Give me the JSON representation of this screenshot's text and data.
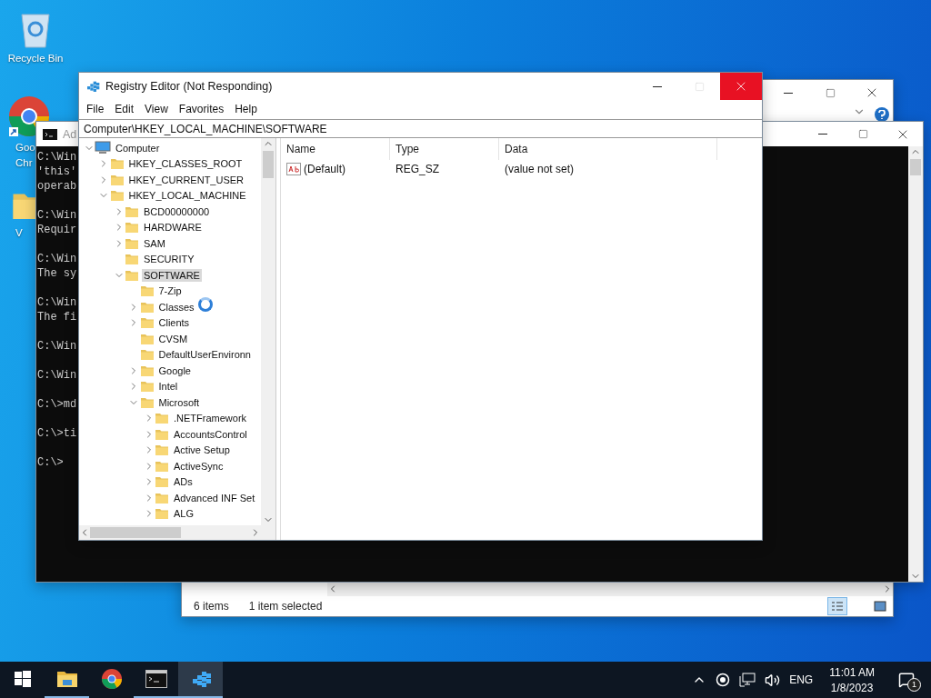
{
  "desktop_icons": [
    {
      "kind": "recycle",
      "lines": [
        "Recycle Bin"
      ]
    },
    {
      "kind": "chrome",
      "lines": [
        "Goo",
        "Chr"
      ]
    },
    {
      "kind": "folder",
      "lines": [
        "V"
      ]
    }
  ],
  "explorer_window": {
    "status_count": "6 items",
    "status_selected": "1 item selected"
  },
  "cmd_window": {
    "title": "Ad",
    "blocks": [
      [
        "C:\\Win",
        "'this'",
        "operab"
      ],
      [
        "C:\\Win",
        "Requir"
      ],
      [
        "C:\\Win",
        "The sy"
      ],
      [
        "C:\\Win",
        "The fi"
      ],
      [
        "C:\\Win"
      ],
      [
        "C:\\Win"
      ],
      [
        "C:\\>md"
      ],
      [
        "C:\\>ti"
      ],
      [
        "C:\\>"
      ]
    ]
  },
  "registry_editor": {
    "title": "Registry Editor (Not Responding)",
    "maximize_disabled": true,
    "close_hovered": true,
    "menu": [
      "File",
      "Edit",
      "View",
      "Favorites",
      "Help"
    ],
    "address": "Computer\\HKEY_LOCAL_MACHINE\\SOFTWARE",
    "tree": [
      {
        "label": "Computer",
        "kind": "computer",
        "expandable": true,
        "expanded": true,
        "selected": false,
        "children": [
          {
            "label": "HKEY_CLASSES_ROOT",
            "kind": "folder",
            "expandable": true,
            "expanded": false,
            "selected": false
          },
          {
            "label": "HKEY_CURRENT_USER",
            "kind": "folder",
            "expandable": true,
            "expanded": false,
            "selected": false
          },
          {
            "label": "HKEY_LOCAL_MACHINE",
            "kind": "folder",
            "expandable": true,
            "expanded": true,
            "selected": false,
            "children": [
              {
                "label": "BCD00000000",
                "kind": "folder",
                "expandable": true,
                "expanded": false,
                "selected": false
              },
              {
                "label": "HARDWARE",
                "kind": "folder",
                "expandable": true,
                "expanded": false,
                "selected": false
              },
              {
                "label": "SAM",
                "kind": "folder",
                "expandable": true,
                "expanded": false,
                "selected": false
              },
              {
                "label": "SECURITY",
                "kind": "folder",
                "expandable": false,
                "expanded": false,
                "selected": false
              },
              {
                "label": "SOFTWARE",
                "kind": "folder",
                "expandable": true,
                "expanded": true,
                "selected": true,
                "children": [
                  {
                    "label": "7-Zip",
                    "kind": "folder",
                    "expandable": false,
                    "expanded": false,
                    "selected": false
                  },
                  {
                    "label": "Classes",
                    "kind": "folder",
                    "expandable": true,
                    "expanded": false,
                    "selected": false
                  },
                  {
                    "label": "Clients",
                    "kind": "folder",
                    "expandable": true,
                    "expanded": false,
                    "selected": false
                  },
                  {
                    "label": "CVSM",
                    "kind": "folder",
                    "expandable": false,
                    "expanded": false,
                    "selected": false
                  },
                  {
                    "label": "DefaultUserEnvironn",
                    "kind": "folder",
                    "expandable": false,
                    "expanded": false,
                    "selected": false
                  },
                  {
                    "label": "Google",
                    "kind": "folder",
                    "expandable": true,
                    "expanded": false,
                    "selected": false
                  },
                  {
                    "label": "Intel",
                    "kind": "folder",
                    "expandable": true,
                    "expanded": false,
                    "selected": false
                  },
                  {
                    "label": "Microsoft",
                    "kind": "folder",
                    "expandable": true,
                    "expanded": true,
                    "selected": false,
                    "children": [
                      {
                        "label": ".NETFramework",
                        "kind": "folder",
                        "expandable": true,
                        "expanded": false,
                        "selected": false
                      },
                      {
                        "label": "AccountsControl",
                        "kind": "folder",
                        "expandable": true,
                        "expanded": false,
                        "selected": false
                      },
                      {
                        "label": "Active Setup",
                        "kind": "folder",
                        "expandable": true,
                        "expanded": false,
                        "selected": false
                      },
                      {
                        "label": "ActiveSync",
                        "kind": "folder",
                        "expandable": true,
                        "expanded": false,
                        "selected": false
                      },
                      {
                        "label": "ADs",
                        "kind": "folder",
                        "expandable": true,
                        "expanded": false,
                        "selected": false
                      },
                      {
                        "label": "Advanced INF Set",
                        "kind": "folder",
                        "expandable": true,
                        "expanded": false,
                        "selected": false
                      },
                      {
                        "label": "ALG",
                        "kind": "folder",
                        "expandable": true,
                        "expanded": false,
                        "selected": false
                      }
                    ]
                  }
                ]
              }
            ]
          }
        ]
      }
    ],
    "columns": [
      "Name",
      "Type",
      "Data"
    ],
    "values": [
      {
        "name": "(Default)",
        "type": "REG_SZ",
        "data": "(value not set)",
        "selected": false
      }
    ]
  },
  "taskbar": {
    "apps": [
      {
        "kind": "explorer",
        "running": true,
        "selected": false
      },
      {
        "kind": "chrome",
        "running": false,
        "selected": false
      },
      {
        "kind": "cmd",
        "running": true,
        "selected": false
      },
      {
        "kind": "regedit",
        "running": true,
        "selected": true
      }
    ],
    "language": "ENG",
    "time": "11:01 AM",
    "date": "1/8/2023",
    "notification_count": "1"
  }
}
